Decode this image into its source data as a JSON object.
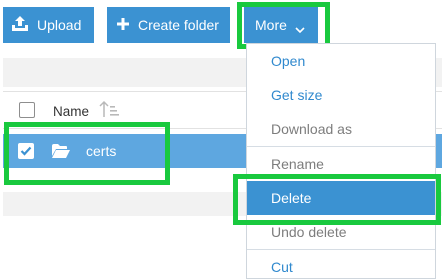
{
  "toolbar": {
    "upload_label": "Upload",
    "create_folder_label": "Create folder",
    "more_label": "More"
  },
  "file_list": {
    "header": {
      "name_label": "Name"
    },
    "rows": [
      {
        "name": "certs",
        "type": "folder",
        "selected": true
      }
    ]
  },
  "more_menu": {
    "items": [
      {
        "label": "Open",
        "enabled": true,
        "active": false
      },
      {
        "label": "Get size",
        "enabled": true,
        "active": false
      },
      {
        "label": "Download as",
        "enabled": false,
        "active": false
      },
      {
        "label": "Rename",
        "enabled": false,
        "active": false
      },
      {
        "label": "Delete",
        "enabled": true,
        "active": true
      },
      {
        "label": "Undo delete",
        "enabled": false,
        "active": false
      },
      {
        "label": "Cut",
        "enabled": true,
        "active": false
      }
    ]
  },
  "colors": {
    "accent": "#3b92d2",
    "selection": "#5ea7e0",
    "highlight": "#19c93e",
    "menu_text": "#3089ce",
    "menu_disabled_text": "#7d7d7d"
  }
}
